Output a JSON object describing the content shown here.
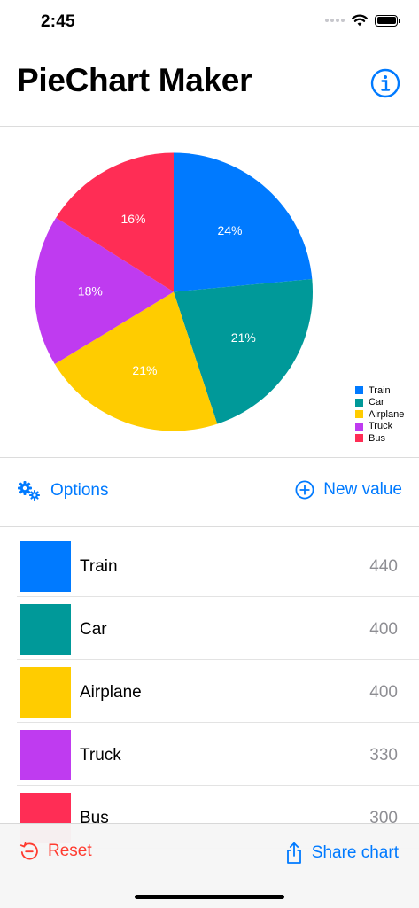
{
  "status": {
    "time": "2:45"
  },
  "nav": {
    "title": "PieChart Maker"
  },
  "chart_data": {
    "type": "pie",
    "categories": [
      "Train",
      "Car",
      "Airplane",
      "Truck",
      "Bus"
    ],
    "values": [
      440,
      400,
      400,
      330,
      300
    ],
    "percent_labels": [
      "24%",
      "21%",
      "21%",
      "18%",
      "16%"
    ],
    "colors": [
      "#007aff",
      "#009999",
      "#ffcc00",
      "#bf3bf0",
      "#ff2d55"
    ],
    "legend": "right",
    "title": "",
    "start_angle": "12 o'clock",
    "direction": "clockwise"
  },
  "toolbar": {
    "options_label": "Options",
    "new_value_label": "New value"
  },
  "items": [
    {
      "name": "Train",
      "value": "440",
      "color": "#007aff"
    },
    {
      "name": "Car",
      "value": "400",
      "color": "#009999"
    },
    {
      "name": "Airplane",
      "value": "400",
      "color": "#ffcc00"
    },
    {
      "name": "Truck",
      "value": "330",
      "color": "#bf3bf0"
    },
    {
      "name": "Bus",
      "value": "300",
      "color": "#ff2d55"
    }
  ],
  "bottom": {
    "reset_label": "Reset",
    "share_label": "Share chart"
  },
  "icons": {
    "info": "info-circle-icon",
    "options": "gears-icon",
    "new_value": "plus-circle-icon",
    "reset": "reset-arrow-icon",
    "share": "share-icon"
  }
}
